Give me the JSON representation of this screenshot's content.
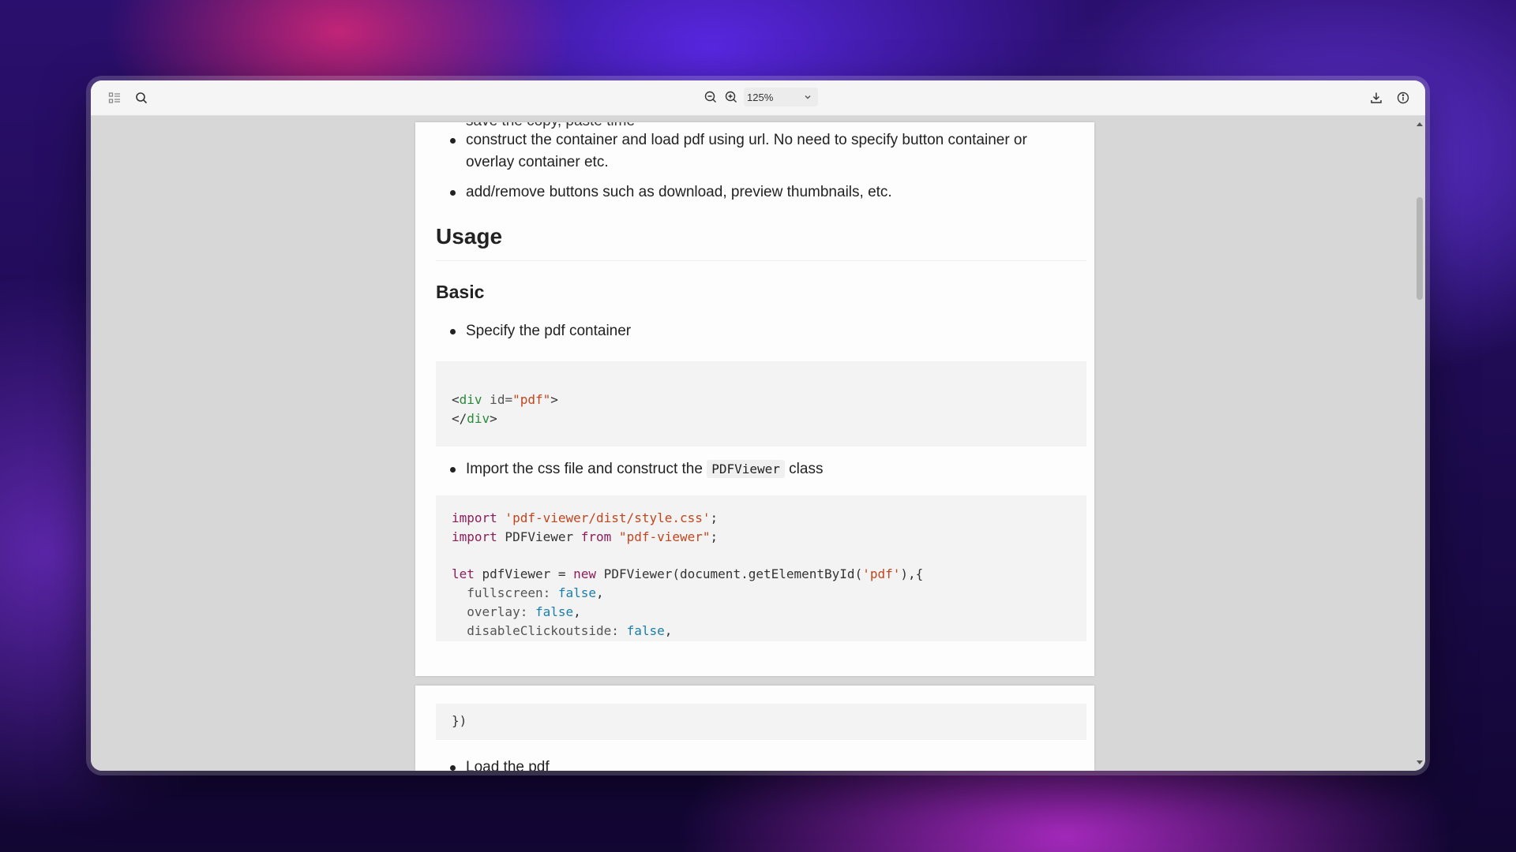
{
  "toolbar": {
    "sidebar_toggle_icon": "sidebar-toggle-icon",
    "search_icon": "search-icon",
    "zoom_out_icon": "zoom-out-icon",
    "zoom_in_icon": "zoom-in-icon",
    "zoom_level": "125%",
    "download_icon": "download-icon",
    "info_icon": "info-icon"
  },
  "document": {
    "cut_top_text": "save the copy, paste time",
    "bullets_top": [
      "construct the container and load pdf using url. No need to specify button container or overlay container etc.",
      "add/remove buttons such as download, preview thumbnails, etc."
    ],
    "heading_usage": "Usage",
    "heading_basic": "Basic",
    "bullet_specify": "Specify the pdf container",
    "code1": {
      "line1_open": "<",
      "line1_tag": "div",
      "line1_attr": " id=",
      "line1_val": "\"pdf\"",
      "line1_close": ">",
      "line2_open": "</",
      "line2_tag": "div",
      "line2_close": ">"
    },
    "bullet_import_prefix": "Import the css file and construct the ",
    "bullet_import_code": "PDFViewer",
    "bullet_import_suffix": " class",
    "code2": {
      "l1_kw": "import",
      "l1_str": " 'pdf-viewer/dist/style.css'",
      "l1_end": ";",
      "l2_kw": "import",
      "l2_mid": " PDFViewer ",
      "l2_kw2": "from",
      "l2_str": " \"pdf-viewer\"",
      "l2_end": ";",
      "l3_kw": "let",
      "l3_mid": " pdfViewer = ",
      "l3_kw2": "new",
      "l3_rest": " PDFViewer(document.getElementById(",
      "l3_str": "'pdf'",
      "l3_end": "),{",
      "l4_prop": "  fullscreen: ",
      "l4_bool": "false",
      "l4_end": ",",
      "l5_prop": "  overlay: ",
      "l5_bool": "false",
      "l5_end": ",",
      "l6_prop": "  disableClickoutside: ",
      "l6_bool": "false",
      "l6_end": ","
    },
    "code3_line": "})",
    "bullet_load": "Load the pdf"
  }
}
